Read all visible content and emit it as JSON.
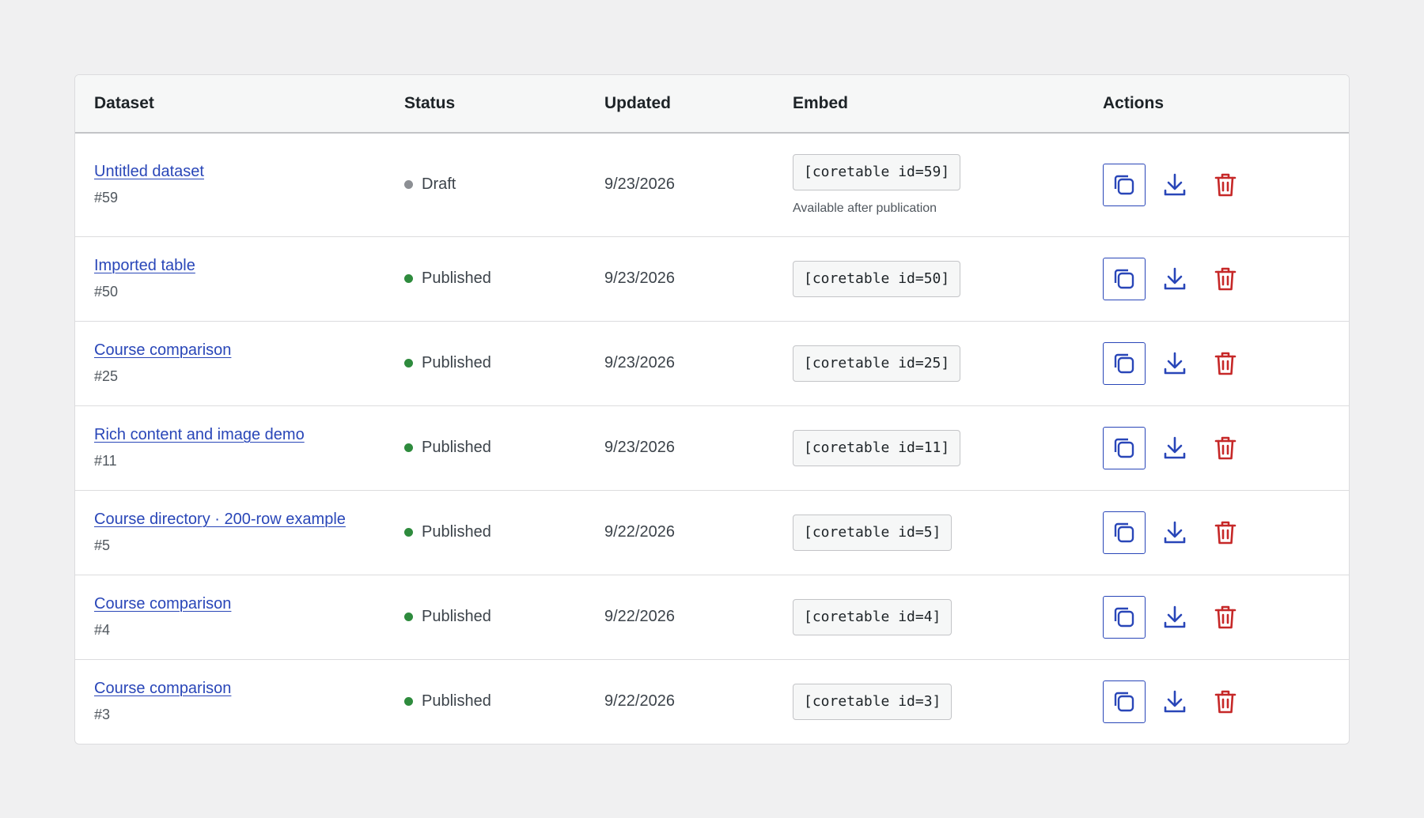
{
  "table": {
    "headers": {
      "dataset": "Dataset",
      "status": "Status",
      "updated": "Updated",
      "embed": "Embed",
      "actions": "Actions"
    },
    "rows": [
      {
        "name": "Untitled dataset",
        "id": "#59",
        "status": "Draft",
        "status_color": "#8c8f94",
        "updated": "9/23/2026",
        "embed": "[coretable id=59]",
        "note": "Available after publication"
      },
      {
        "name": "Imported table",
        "id": "#50",
        "status": "Published",
        "status_color": "#2e8b3d",
        "updated": "9/23/2026",
        "embed": "[coretable id=50]",
        "note": ""
      },
      {
        "name": "Course comparison",
        "id": "#25",
        "status": "Published",
        "status_color": "#2e8b3d",
        "updated": "9/23/2026",
        "embed": "[coretable id=25]",
        "note": ""
      },
      {
        "name": "Rich content and image demo",
        "id": "#11",
        "status": "Published",
        "status_color": "#2e8b3d",
        "updated": "9/23/2026",
        "embed": "[coretable id=11]",
        "note": ""
      },
      {
        "name": "Course directory · 200-row example",
        "id": "#5",
        "status": "Published",
        "status_color": "#2e8b3d",
        "updated": "9/22/2026",
        "embed": "[coretable id=5]",
        "note": ""
      },
      {
        "name": "Course comparison",
        "id": "#4",
        "status": "Published",
        "status_color": "#2e8b3d",
        "updated": "9/22/2026",
        "embed": "[coretable id=4]",
        "note": ""
      },
      {
        "name": "Course comparison",
        "id": "#3",
        "status": "Published",
        "status_color": "#2e8b3d",
        "updated": "9/22/2026",
        "embed": "[coretable id=3]",
        "note": ""
      }
    ]
  },
  "icons": {
    "copy": "copy-icon",
    "download": "download-icon",
    "delete": "trash-icon"
  },
  "colors": {
    "link": "#2946b8",
    "action_blue": "#2946b8",
    "danger": "#c62828"
  }
}
